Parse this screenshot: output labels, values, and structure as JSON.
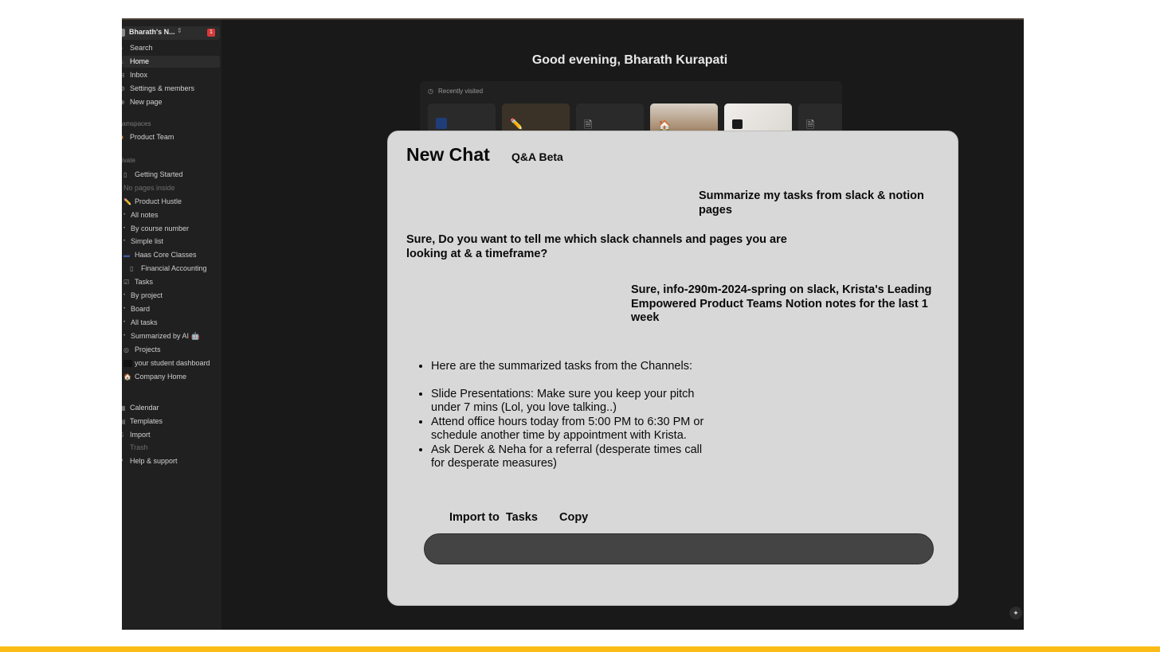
{
  "workspace": {
    "name": "Bharath's N...",
    "switch_icon": "chevron-updown-icon",
    "badge": "1"
  },
  "nav": [
    {
      "label": "Search",
      "icon": "search-icon",
      "glyph": "⌕",
      "active": false
    },
    {
      "label": "Home",
      "icon": "home-icon",
      "glyph": "⌂",
      "active": true
    },
    {
      "label": "Inbox",
      "icon": "inbox-icon",
      "glyph": "⊟",
      "active": false
    },
    {
      "label": "Settings & members",
      "icon": "gear-icon",
      "glyph": "⚙",
      "active": false
    },
    {
      "label": "New page",
      "icon": "plus-circle-icon",
      "glyph": "⊕",
      "active": false
    }
  ],
  "sections": {
    "teamspaces": "amspaces",
    "private": "ivate"
  },
  "teamspace": {
    "label": "Product Team",
    "icon": "team-icon"
  },
  "private_pages": [
    {
      "label": "Getting Started",
      "icon": "page-icon",
      "glyph": "▯",
      "kind": "page"
    },
    {
      "label": "No pages inside",
      "icon": "",
      "glyph": "",
      "kind": "muted"
    },
    {
      "label": "Product Hustle",
      "icon": "pencil-icon",
      "glyph": "✏️",
      "kind": "page"
    },
    {
      "label": "All notes",
      "icon": "bullet-icon",
      "glyph": "•",
      "kind": "sub"
    },
    {
      "label": "By course number",
      "icon": "bullet-icon",
      "glyph": "•",
      "kind": "sub"
    },
    {
      "label": "Simple list",
      "icon": "bullet-icon",
      "glyph": "•",
      "kind": "sub"
    },
    {
      "label": "Haas Core Classes",
      "icon": "haas-logo-icon",
      "glyph": "▬",
      "kind": "page"
    },
    {
      "label": "Financial Accounting",
      "icon": "notebook-icon",
      "glyph": "▯",
      "kind": "page"
    },
    {
      "label": "Tasks",
      "icon": "checkbox-icon",
      "glyph": "☑",
      "kind": "page"
    },
    {
      "label": "By project",
      "icon": "bullet-icon",
      "glyph": "•",
      "kind": "sub"
    },
    {
      "label": "Board",
      "icon": "bullet-icon",
      "glyph": "•",
      "kind": "sub"
    },
    {
      "label": "All tasks",
      "icon": "bullet-icon",
      "glyph": "•",
      "kind": "sub"
    },
    {
      "label": "Summarized by AI 🤖",
      "icon": "bullet-icon",
      "glyph": "•",
      "kind": "sub"
    },
    {
      "label": "Projects",
      "icon": "target-icon",
      "glyph": "◎",
      "kind": "page"
    },
    {
      "label": "your student dashboard",
      "icon": "dashboard-icon",
      "glyph": "",
      "kind": "dark"
    },
    {
      "label": "Company Home",
      "icon": "house-emoji-icon",
      "glyph": "🏠",
      "kind": "page"
    }
  ],
  "bottom_nav": [
    {
      "label": "Calendar",
      "icon": "calendar-icon",
      "glyph": "▦"
    },
    {
      "label": "Templates",
      "icon": "templates-icon",
      "glyph": "▤"
    },
    {
      "label": "Import",
      "icon": "import-icon",
      "glyph": "⇩"
    },
    {
      "label": "Trash",
      "icon": "trash-icon",
      "glyph": "🗑"
    },
    {
      "label": "Help & support",
      "icon": "help-icon",
      "glyph": "?"
    }
  ],
  "main": {
    "greeting": "Good evening, Bharath Kurapati",
    "recent_title": "Recently visited"
  },
  "chat": {
    "title": "New Chat",
    "badge": "Q&A Beta",
    "messages": {
      "user1": "Summarize my tasks from slack & notion pages",
      "bot1": "Sure, Do you want to tell me which slack channels and pages you are looking at & a timeframe?",
      "user2": "Sure, info-290m-2024-spring on slack, Krista's Leading Empowered Product Teams Notion notes for the last 1 week"
    },
    "answer": {
      "intro": "Here are the summarized tasks from the Channels:",
      "items": [
        "Slide Presentations: Make sure you keep your pitch under 7 mins (Lol, you love talking..)",
        "Attend office hours today from 5:00 PM to 6:30 PM or schedule another time by appointment with Krista.",
        "Ask Derek & Neha for a referral (desperate times call for desperate measures)"
      ]
    },
    "actions": {
      "import": "Import to  Tasks",
      "copy": "Copy"
    },
    "input_placeholder": ""
  },
  "colors": {
    "app_bg": "#191919",
    "sidebar_bg": "#202020",
    "chat_bg": "#d8d8d8",
    "input_bg": "#444444",
    "accent_bar": "#fbbc15"
  }
}
